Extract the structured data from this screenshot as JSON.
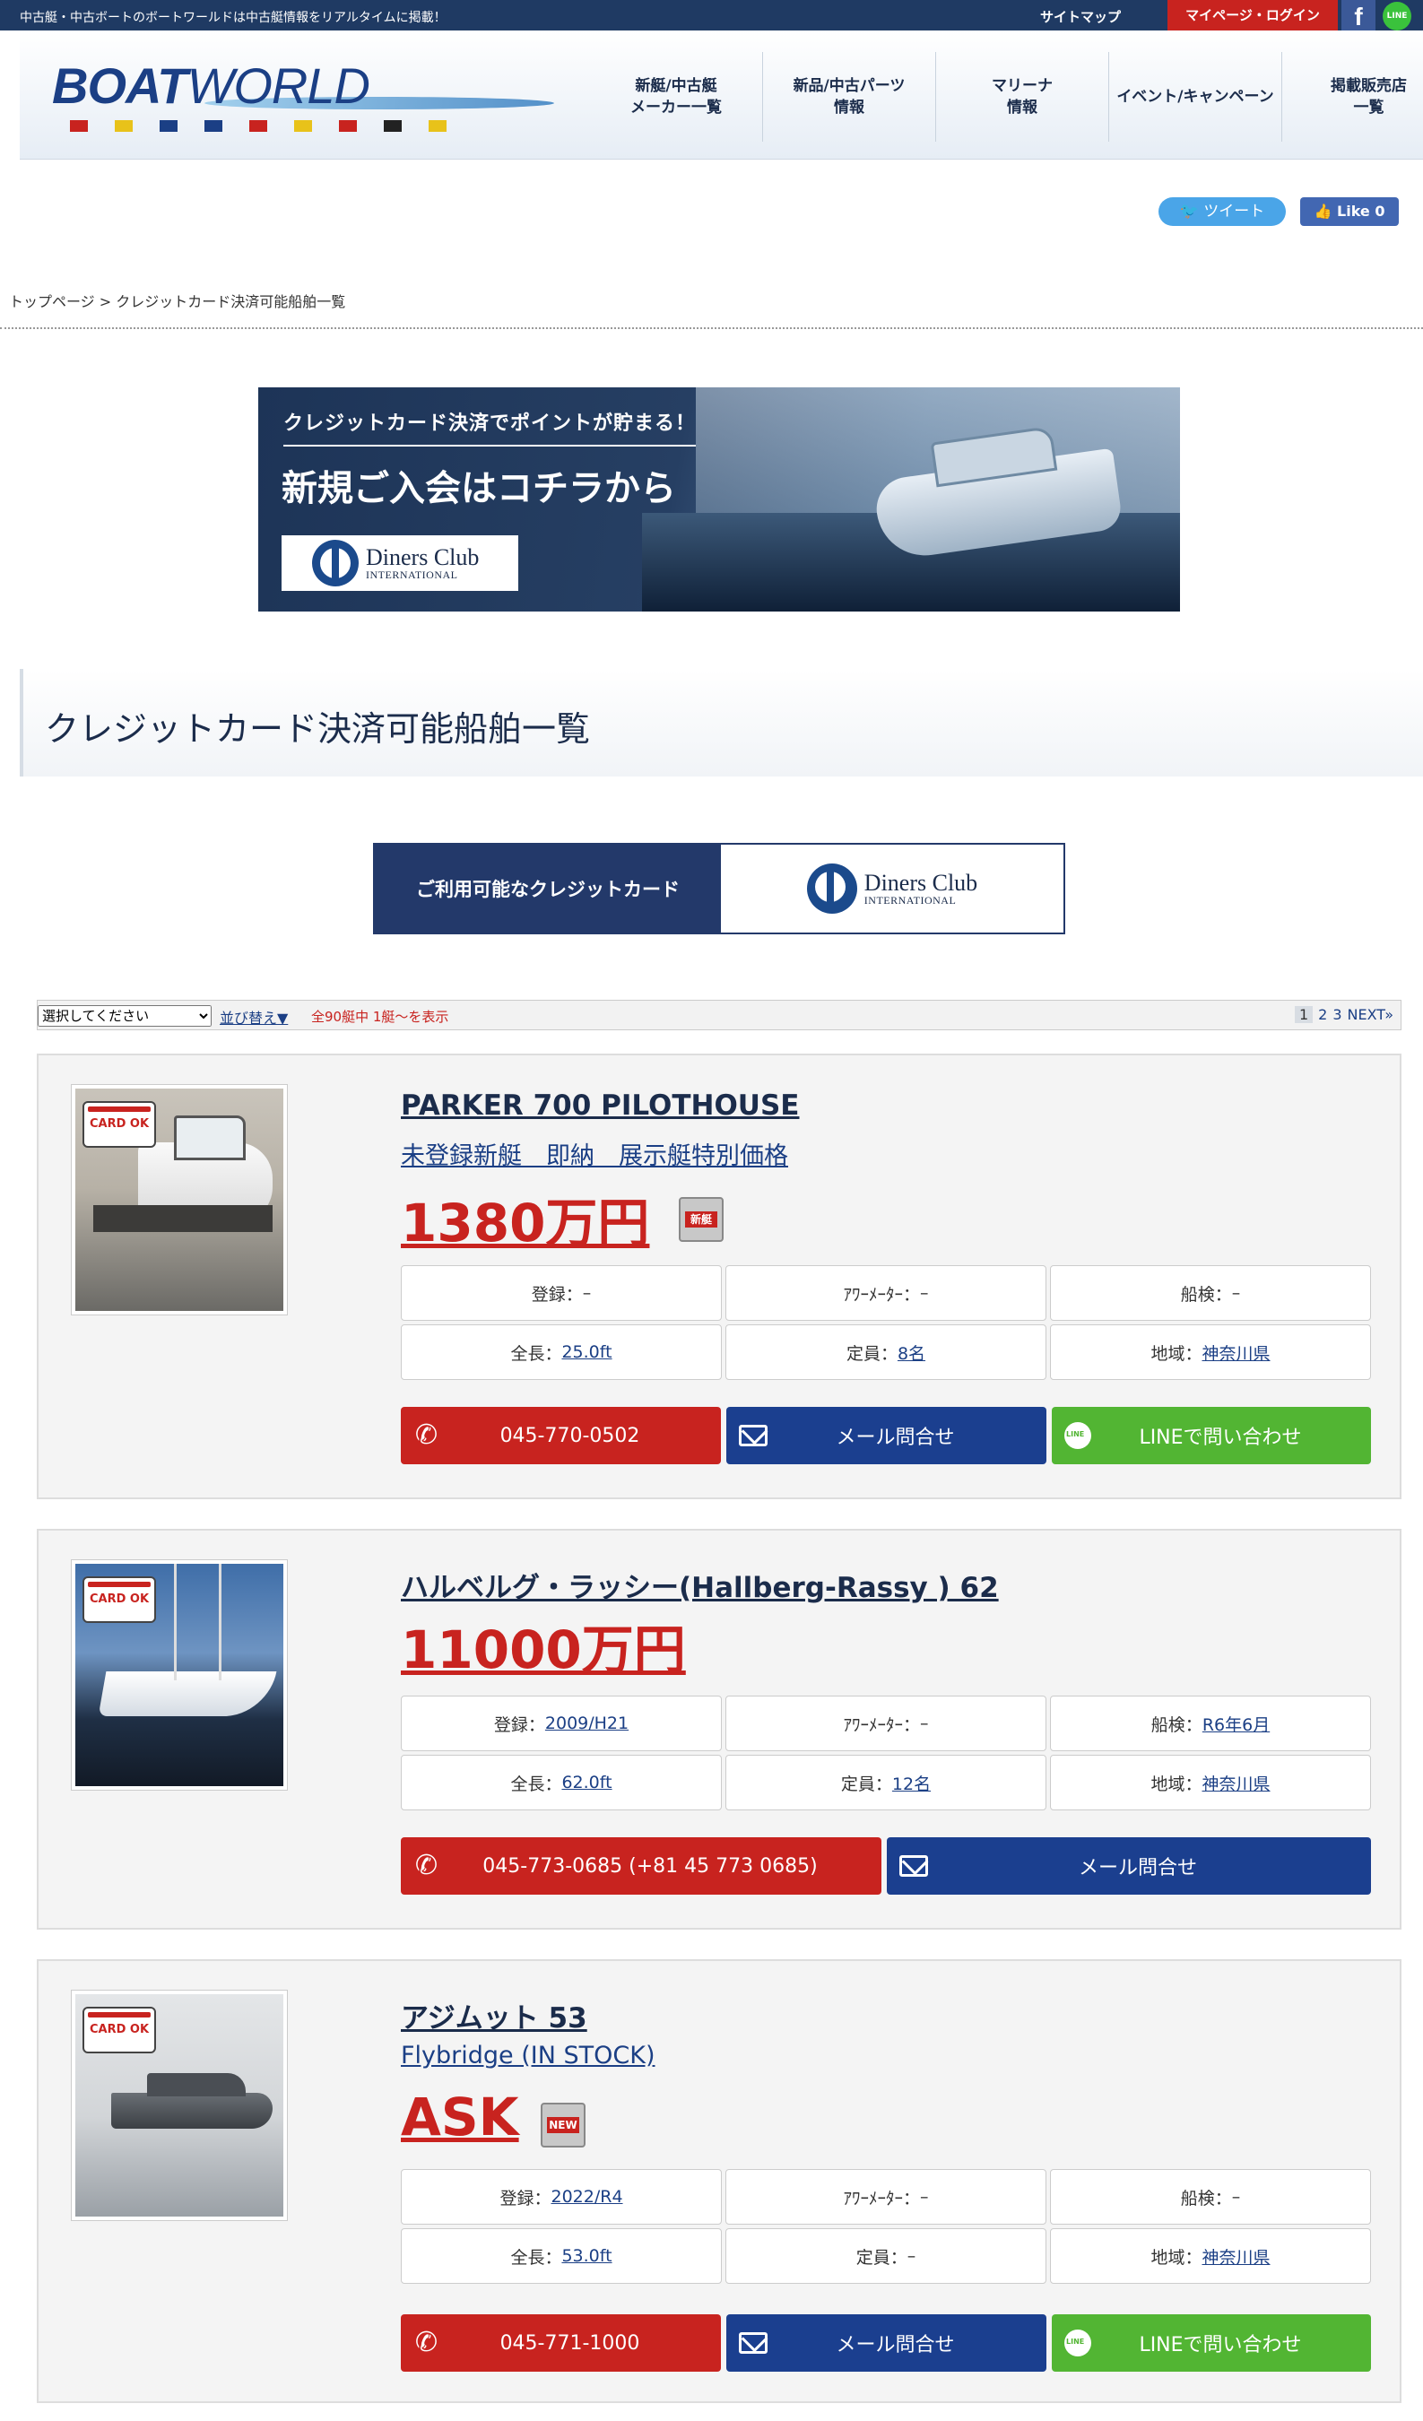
{
  "topbar": {
    "tagline": "中古艇・中古ボートのボートワールドは中古艇情報をリアルタイムに掲載！",
    "sitemap": "サイトマップ",
    "login": "マイページ・ログイン",
    "facebook_icon": "facebook-icon",
    "line_icon": "line-icon",
    "line_text": "LINE"
  },
  "logo": {
    "text_bold": "BOAT",
    "text_light": "WORLD"
  },
  "nav": [
    {
      "label": "新艇/中古艇\nメーカー一覧"
    },
    {
      "label": "新品/中古パーツ\n情報"
    },
    {
      "label": "マリーナ\n情報"
    },
    {
      "label": "イベント/キャンペーン"
    },
    {
      "label": "掲載販売店\n一覧"
    }
  ],
  "social": {
    "tweet": "ツイート",
    "like": "Like 0"
  },
  "breadcrumb": {
    "home": "トップページ",
    "sep": ">",
    "current": "クレジットカード決済可能船舶一覧"
  },
  "banner": {
    "line1": "クレジットカード決済でポイントが貯まる！",
    "line2": "新規ご入会はコチラから"
  },
  "diners": {
    "name": "Diners Club",
    "sub": "INTERNATIONAL"
  },
  "page_title": "クレジットカード決済可能船舶一覧",
  "available_cards": {
    "label": "ご利用可能なクレジットカード"
  },
  "toolbar": {
    "select_value": "選択してください",
    "sort": "並び替え▼",
    "count": "全90艇中 1艇〜を表示",
    "pages": [
      "1",
      "2",
      "3",
      "NEXT»"
    ]
  },
  "card_ok": "CARD OK",
  "listings": [
    {
      "title": "PARKER 700 PILOTHOUSE",
      "subtitle": "未登録新艇　即納　展示艇特別価格",
      "price": "1380万円",
      "badge": "新艇",
      "specs": [
        {
          "label": "登録：",
          "value": "–"
        },
        {
          "label": "ｱﾜｰﾒｰﾀｰ：",
          "value": "–"
        },
        {
          "label": "船検：",
          "value": "–"
        },
        {
          "label": "全長：",
          "value": "25.0ft"
        },
        {
          "label": "定員：",
          "value": "8名"
        },
        {
          "label": "地域：",
          "value": "神奈川県"
        }
      ],
      "phone": "045-770-0502",
      "mail": "メール問合せ",
      "line": "LINEで問い合わせ"
    },
    {
      "title": "ハルベルグ・ラッシー(Hallberg-Rassy ) 62",
      "subtitle": "",
      "price": "11000万円",
      "badge": "",
      "specs": [
        {
          "label": "登録：",
          "value": "2009/H21"
        },
        {
          "label": "ｱﾜｰﾒｰﾀｰ：",
          "value": "–"
        },
        {
          "label": "船検：",
          "value": "R6年6月"
        },
        {
          "label": "全長：",
          "value": "62.0ft"
        },
        {
          "label": "定員：",
          "value": "12名"
        },
        {
          "label": "地域：",
          "value": "神奈川県"
        }
      ],
      "phone": "045-773-0685 (+81 45 773 0685)",
      "mail": "メール問合せ",
      "line": ""
    },
    {
      "title": "アジムット 53",
      "subtitle": "Flybridge (IN STOCK)",
      "price": "ASK",
      "badge": "NEW",
      "specs": [
        {
          "label": "登録：",
          "value": "2022/R4"
        },
        {
          "label": "ｱﾜｰﾒｰﾀｰ：",
          "value": "–"
        },
        {
          "label": "船検：",
          "value": "–"
        },
        {
          "label": "全長：",
          "value": "53.0ft"
        },
        {
          "label": "定員：",
          "value": "–"
        },
        {
          "label": "地域：",
          "value": "神奈川県"
        }
      ],
      "phone": "045-771-1000",
      "mail": "メール問合せ",
      "line": "LINEで問い合わせ"
    }
  ]
}
